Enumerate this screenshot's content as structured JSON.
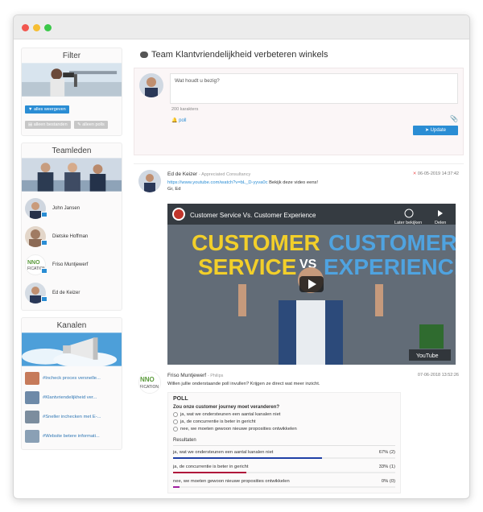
{
  "sidebar": {
    "filter": {
      "title": "Filter",
      "btn_all": "alles weergeven",
      "btn_files": "alleen bestanden",
      "btn_polls": "alleen polls"
    },
    "team": {
      "title": "Teamleden",
      "members": [
        {
          "name": "John Jansen"
        },
        {
          "name": "Dietske Hoffman"
        },
        {
          "name": "Friso Muntjewerf"
        },
        {
          "name": "Ed de Keizer"
        }
      ]
    },
    "channels": {
      "title": "Kanalen",
      "items": [
        {
          "label": "#Incheck proces versnelle..."
        },
        {
          "label": "#Klantvriendelijkheid ver..."
        },
        {
          "label": "#Sneller inchecken met E-..."
        },
        {
          "label": "#Website betere informati..."
        }
      ]
    }
  },
  "main": {
    "title": "Team Klantvriendelijkheid verbeteren winkels",
    "composer": {
      "placeholder": "Wat houdt u bezig?",
      "char_count": "200 karakters",
      "poll_link": "poll",
      "update_label": "Update"
    },
    "posts": [
      {
        "author": "Ed de Keizer",
        "company": "- Appreciated Consultancy",
        "date": "06-05-2019 14:37:42",
        "link": "https://www.youtube.com/watch?v=bL_D-yyva0c",
        "text_after_link": " Bekijk deze video eens!",
        "sign": "Gr, Ed",
        "video": {
          "title": "Customer Service Vs. Customer Experience",
          "watch_later": "Later bekijken",
          "share": "Delen",
          "left_word1": "CUSTOMER",
          "left_word2": "SERVICE",
          "vs": "VS",
          "right_word1": "CUSTOMER",
          "right_word2": "EXPERIENCE",
          "youtube_label": "YouTube"
        }
      },
      {
        "author": "Friso Muntjewerf",
        "company": "- Philips",
        "date": "07-06-2018 13:52:26",
        "text": "Willen jullie onderstaande poll invullen? Krijgen ze direct wat meer inzicht.",
        "poll": {
          "heading": "POLL",
          "question": "Zou onze customer journey moet veranderen?",
          "options": [
            "ja, wat we ondersteunen een aantal kanalen niet",
            "ja, de concurrentie is beter in gericht",
            "nee, we moeten gewoon nieuwe proposities ontwikkelen"
          ],
          "results_heading": "Resultaten",
          "results": [
            {
              "label": "ja, wat we ondersteunen een aantal kanalen niet",
              "value": "67% (2)",
              "pct": 67,
              "color": "#1f3fa6"
            },
            {
              "label": "ja, de concurrentie is beter in gericht",
              "value": "33% (1)",
              "pct": 33,
              "color": "#b0143a"
            },
            {
              "label": "nee, we moeten gewoon nieuwe proposities ontwikkelen",
              "value": "0% (0)",
              "pct": 3,
              "color": "#a01ea0"
            }
          ]
        }
      }
    ]
  }
}
